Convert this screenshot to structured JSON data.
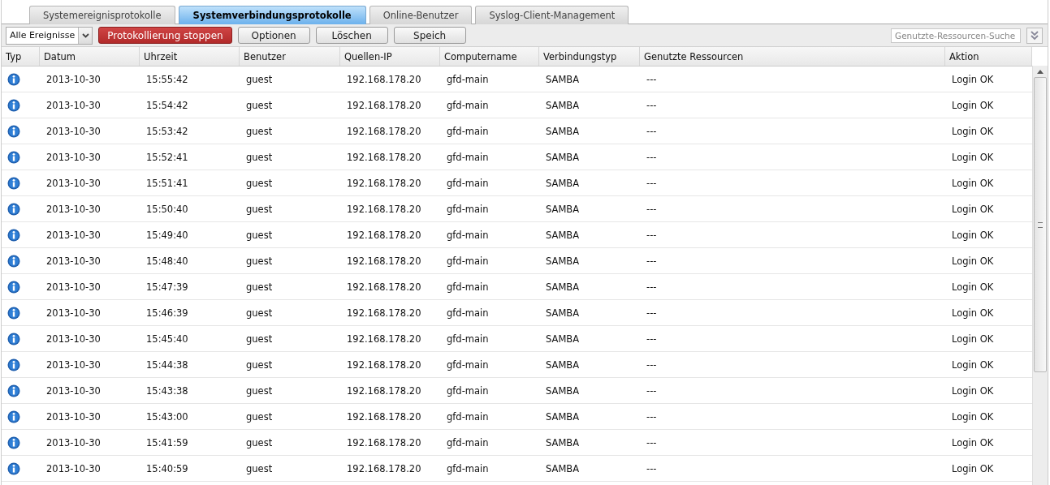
{
  "tabs": [
    {
      "label": "Systemereignisprotokolle",
      "selected": false
    },
    {
      "label": "Systemverbindungsprotokolle",
      "selected": true
    },
    {
      "label": "Online-Benutzer",
      "selected": false
    },
    {
      "label": "Syslog-Client-Management",
      "selected": false
    }
  ],
  "toolbar": {
    "filter": "Alle Ereignisse",
    "buttons": [
      {
        "label": "Protokollierung stoppen",
        "kind": "danger"
      },
      {
        "label": "Optionen",
        "kind": "normal"
      },
      {
        "label": "Löschen",
        "kind": "normal"
      },
      {
        "label": "Speich",
        "kind": "normal"
      }
    ],
    "search": {
      "placeholder": "Genutzte-Ressourcen-Suche"
    }
  },
  "table": {
    "columns": [
      "Typ",
      "Datum",
      "Uhrzeit",
      "Benutzer",
      "Quellen-IP",
      "Computername",
      "Verbindungstyp",
      "Genutzte Ressourcen",
      "Aktion"
    ],
    "rows": [
      {
        "kind": "info",
        "cells": [
          "",
          "2013-10-30",
          "15:55:42",
          "guest",
          "192.168.178.20",
          "gfd-main",
          "SAMBA",
          "---",
          "Login OK"
        ]
      },
      {
        "kind": "info",
        "cells": [
          "",
          "2013-10-30",
          "15:54:42",
          "guest",
          "192.168.178.20",
          "gfd-main",
          "SAMBA",
          "---",
          "Login OK"
        ]
      },
      {
        "kind": "info",
        "cells": [
          "",
          "2013-10-30",
          "15:53:42",
          "guest",
          "192.168.178.20",
          "gfd-main",
          "SAMBA",
          "---",
          "Login OK"
        ]
      },
      {
        "kind": "info",
        "cells": [
          "",
          "2013-10-30",
          "15:52:41",
          "guest",
          "192.168.178.20",
          "gfd-main",
          "SAMBA",
          "---",
          "Login OK"
        ]
      },
      {
        "kind": "info",
        "cells": [
          "",
          "2013-10-30",
          "15:51:41",
          "guest",
          "192.168.178.20",
          "gfd-main",
          "SAMBA",
          "---",
          "Login OK"
        ]
      },
      {
        "kind": "info",
        "cells": [
          "",
          "2013-10-30",
          "15:50:40",
          "guest",
          "192.168.178.20",
          "gfd-main",
          "SAMBA",
          "---",
          "Login OK"
        ]
      },
      {
        "kind": "info",
        "cells": [
          "",
          "2013-10-30",
          "15:49:40",
          "guest",
          "192.168.178.20",
          "gfd-main",
          "SAMBA",
          "---",
          "Login OK"
        ]
      },
      {
        "kind": "info",
        "cells": [
          "",
          "2013-10-30",
          "15:48:40",
          "guest",
          "192.168.178.20",
          "gfd-main",
          "SAMBA",
          "---",
          "Login OK"
        ]
      },
      {
        "kind": "info",
        "cells": [
          "",
          "2013-10-30",
          "15:47:39",
          "guest",
          "192.168.178.20",
          "gfd-main",
          "SAMBA",
          "---",
          "Login OK"
        ]
      },
      {
        "kind": "info",
        "cells": [
          "",
          "2013-10-30",
          "15:46:39",
          "guest",
          "192.168.178.20",
          "gfd-main",
          "SAMBA",
          "---",
          "Login OK"
        ]
      },
      {
        "kind": "info",
        "cells": [
          "",
          "2013-10-30",
          "15:45:40",
          "guest",
          "192.168.178.20",
          "gfd-main",
          "SAMBA",
          "---",
          "Login OK"
        ]
      },
      {
        "kind": "info",
        "cells": [
          "",
          "2013-10-30",
          "15:44:38",
          "guest",
          "192.168.178.20",
          "gfd-main",
          "SAMBA",
          "---",
          "Login OK"
        ]
      },
      {
        "kind": "info",
        "cells": [
          "",
          "2013-10-30",
          "15:43:38",
          "guest",
          "192.168.178.20",
          "gfd-main",
          "SAMBA",
          "---",
          "Login OK"
        ]
      },
      {
        "kind": "info",
        "cells": [
          "",
          "2013-10-30",
          "15:43:00",
          "guest",
          "192.168.178.20",
          "gfd-main",
          "SAMBA",
          "---",
          "Login OK"
        ]
      },
      {
        "kind": "info",
        "cells": [
          "",
          "2013-10-30",
          "15:41:59",
          "guest",
          "192.168.178.20",
          "gfd-main",
          "SAMBA",
          "---",
          "Login OK"
        ]
      },
      {
        "kind": "info",
        "cells": [
          "",
          "2013-10-30",
          "15:40:59",
          "guest",
          "192.168.178.20",
          "gfd-main",
          "SAMBA",
          "---",
          "Login OK"
        ]
      }
    ]
  }
}
